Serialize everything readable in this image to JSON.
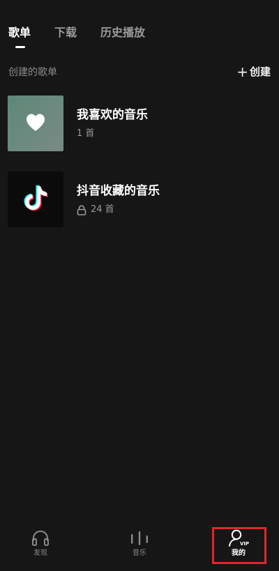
{
  "tabs": [
    {
      "label": "歌单",
      "active": true
    },
    {
      "label": "下载",
      "active": false
    },
    {
      "label": "历史播放",
      "active": false
    }
  ],
  "section": {
    "title": "创建的歌单",
    "create_label": "创建"
  },
  "playlists": [
    {
      "name": "我喜欢的音乐",
      "count": "1 首",
      "icon": "heart-icon",
      "locked": false
    },
    {
      "name": "抖音收藏的音乐",
      "count": "24 首",
      "icon": "tiktok-icon",
      "locked": true
    }
  ],
  "bottom_nav": [
    {
      "label": "发现",
      "icon": "headphones-icon",
      "active": false
    },
    {
      "label": "音乐",
      "icon": "equalizer-icon",
      "active": false
    },
    {
      "label": "我的",
      "icon": "user-vip-icon",
      "active": true
    }
  ],
  "colors": {
    "background": "#161616",
    "highlight": "#e0262b",
    "muted_text": "#9a9a9a"
  }
}
